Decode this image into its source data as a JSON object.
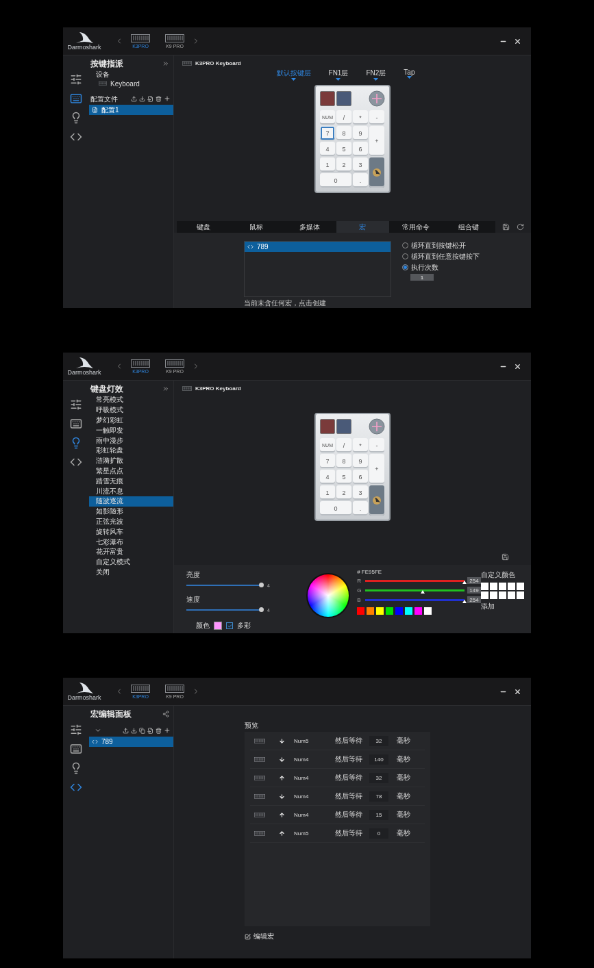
{
  "windows": [
    {
      "kind": "keymap",
      "header": {
        "logo": "Darmoshark",
        "devices": [
          {
            "name": "K3PRO",
            "selected": true
          },
          {
            "name": "K9 PRO",
            "selected": false
          }
        ]
      },
      "rail": [
        {
          "selected": false
        },
        {
          "selected": true
        },
        {
          "selected": false
        },
        {
          "selected": false
        }
      ],
      "sidebar": {
        "title": "按键指派",
        "device_label": "设备",
        "device": "Keyboard",
        "profiles_label": "配置文件",
        "profiles": [
          {
            "name": "配置1",
            "selected": true
          }
        ]
      },
      "main": {
        "device_title": "K3PRO Keyboard",
        "layers": [
          {
            "label": "默认按键层",
            "selected": true
          },
          {
            "label": "FN1层",
            "selected": false
          },
          {
            "label": "FN2层",
            "selected": false
          },
          {
            "label": "Tap",
            "selected": false
          }
        ],
        "keypad": [
          {
            "label": "NUM",
            "kind": "small",
            "selected": false
          },
          {
            "label": "/",
            "kind": "key",
            "selected": false
          },
          {
            "label": "*",
            "kind": "key",
            "selected": false
          },
          {
            "label": "-",
            "kind": "key",
            "selected": false
          },
          {
            "label": "7",
            "kind": "key",
            "selected": true
          },
          {
            "label": "8",
            "kind": "key",
            "selected": false
          },
          {
            "label": "9",
            "kind": "key",
            "selected": false
          },
          {
            "label": "+",
            "kind": "tall",
            "selected": false
          },
          {
            "label": "4",
            "kind": "key",
            "selected": false
          },
          {
            "label": "5",
            "kind": "key",
            "selected": false
          },
          {
            "label": "6",
            "kind": "key",
            "selected": false
          },
          {
            "label": "1",
            "kind": "key",
            "selected": false
          },
          {
            "label": "2",
            "kind": "key",
            "selected": false
          },
          {
            "label": "3",
            "kind": "key",
            "selected": false
          },
          {
            "kind": "enter",
            "selected": false
          },
          {
            "label": "0",
            "kind": "wide",
            "selected": false
          },
          {
            "label": ".",
            "kind": "key",
            "selected": false
          }
        ],
        "function_tabs": [
          {
            "label": "键盘",
            "selected": false
          },
          {
            "label": "鼠标",
            "selected": false
          },
          {
            "label": "多媒体",
            "selected": false
          },
          {
            "label": "宏",
            "selected": true
          },
          {
            "label": "常用命令",
            "selected": false
          },
          {
            "label": "组合键",
            "selected": false
          }
        ],
        "macros": [
          {
            "name": "789",
            "selected": true
          }
        ],
        "macro_hint": "当前未含任何宏，点击创建",
        "repeat_options": [
          {
            "label": "循环直到按键松开",
            "selected": false
          },
          {
            "label": "循环直到任意按键按下",
            "selected": false
          },
          {
            "label": "执行次数",
            "selected": true
          }
        ],
        "repeat_count": "1"
      }
    },
    {
      "kind": "lighting",
      "header": {
        "logo": "Darmoshark",
        "devices": [
          {
            "name": "K3PRO",
            "selected": true
          },
          {
            "name": "K9 PRO",
            "selected": false
          }
        ]
      },
      "rail": [
        {
          "selected": false
        },
        {
          "selected": false
        },
        {
          "selected": true
        },
        {
          "selected": false
        }
      ],
      "sidebar": {
        "title": "键盘灯效",
        "effects": [
          {
            "label": "常亮模式",
            "selected": false
          },
          {
            "label": "呼吸模式",
            "selected": false
          },
          {
            "label": "梦幻彩虹",
            "selected": false
          },
          {
            "label": "一触即发",
            "selected": false
          },
          {
            "label": "雨中漫步",
            "selected": false
          },
          {
            "label": "彩虹轮盘",
            "selected": false
          },
          {
            "label": "涟漪扩散",
            "selected": false
          },
          {
            "label": "繁星点点",
            "selected": false
          },
          {
            "label": "踏雪无痕",
            "selected": false
          },
          {
            "label": "川流不息",
            "selected": false
          },
          {
            "label": "随波逐流",
            "selected": true
          },
          {
            "label": "如影随形",
            "selected": false
          },
          {
            "label": "正弦光波",
            "selected": false
          },
          {
            "label": "旋转风车",
            "selected": false
          },
          {
            "label": "七彩瀑布",
            "selected": false
          },
          {
            "label": "花开富贵",
            "selected": false
          },
          {
            "label": "自定义模式",
            "selected": false
          },
          {
            "label": "关闭",
            "selected": false
          }
        ]
      },
      "main": {
        "device_title": "K3PRO Keyboard",
        "keypad": [
          {
            "label": "NUM",
            "kind": "small"
          },
          {
            "label": "/",
            "kind": "key"
          },
          {
            "label": "*",
            "kind": "key"
          },
          {
            "label": "-",
            "kind": "key"
          },
          {
            "label": "7",
            "kind": "key"
          },
          {
            "label": "8",
            "kind": "key"
          },
          {
            "label": "9",
            "kind": "key"
          },
          {
            "label": "+",
            "kind": "tall"
          },
          {
            "label": "4",
            "kind": "key"
          },
          {
            "label": "5",
            "kind": "key"
          },
          {
            "label": "6",
            "kind": "key"
          },
          {
            "label": "1",
            "kind": "key"
          },
          {
            "label": "2",
            "kind": "key"
          },
          {
            "label": "3",
            "kind": "key"
          },
          {
            "kind": "enter"
          },
          {
            "label": "0",
            "kind": "wide"
          },
          {
            "label": ".",
            "kind": "key"
          }
        ],
        "sliders": [
          {
            "label": "亮度",
            "level": 1,
            "reading": "4"
          },
          {
            "label": "速度",
            "level": 1,
            "reading": "4"
          }
        ],
        "color_label": "颜色",
        "color": "#fe95fe",
        "multicolor": {
          "label": "多彩",
          "checked": true
        },
        "hex": "# FE95FE",
        "channels": [
          {
            "label": "R",
            "level": 1,
            "reading": "254",
            "color": "#e02020"
          },
          {
            "label": "G",
            "level": 0.58,
            "reading": "149",
            "color": "#20c020"
          },
          {
            "label": "B",
            "level": 1,
            "reading": "254",
            "color": "#2030d0"
          }
        ],
        "presets": [
          {
            "color": "#ff0000"
          },
          {
            "color": "#ff8000"
          },
          {
            "color": "#ffff00"
          },
          {
            "color": "#00e000"
          },
          {
            "color": "#0000ff"
          },
          {
            "color": "#00ffff"
          },
          {
            "color": "#ff00ff"
          },
          {
            "color": "#ffffff"
          }
        ],
        "custom_label": "自定义颜色",
        "add_label": "添加"
      }
    },
    {
      "kind": "macro",
      "header": {
        "logo": "Darmoshark",
        "devices": [
          {
            "name": "K3PRO",
            "selected": true
          },
          {
            "name": "K9 PRO",
            "selected": false
          }
        ]
      },
      "rail": [
        {
          "selected": false
        },
        {
          "selected": false
        },
        {
          "selected": false
        },
        {
          "selected": true
        }
      ],
      "sidebar": {
        "title": "宏编辑面板",
        "macros": [
          {
            "name": "789",
            "selected": true
          }
        ]
      },
      "main": {
        "preview_label": "预览",
        "steps": [
          {
            "kind": "down",
            "key": "Num5",
            "wait_label": "然后等待",
            "delay": "32",
            "unit": "毫秒"
          },
          {
            "kind": "down",
            "key": "Num4",
            "wait_label": "然后等待",
            "delay": "140",
            "unit": "毫秒"
          },
          {
            "kind": "up",
            "key": "Num4",
            "wait_label": "然后等待",
            "delay": "32",
            "unit": "毫秒"
          },
          {
            "kind": "down",
            "key": "Num4",
            "wait_label": "然后等待",
            "delay": "78",
            "unit": "毫秒"
          },
          {
            "kind": "up",
            "key": "Num4",
            "wait_label": "然后等待",
            "delay": "15",
            "unit": "毫秒"
          },
          {
            "kind": "up",
            "key": "Num5",
            "wait_label": "然后等待",
            "delay": "0",
            "unit": "毫秒"
          }
        ],
        "edit_label": "编辑宏"
      }
    }
  ]
}
